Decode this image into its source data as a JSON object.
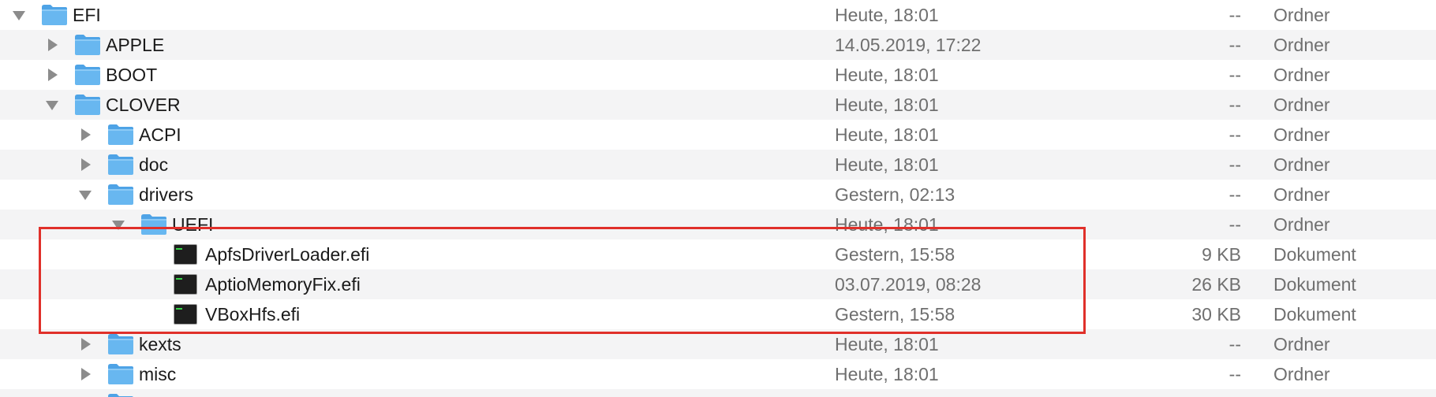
{
  "colors": {
    "folder_blue": "#68b7f0",
    "row_alt": "#f4f4f5",
    "highlight_red": "#e0302a",
    "secondary_text": "#6f6f6f"
  },
  "rows": [
    {
      "name": "EFI",
      "date": "Heute, 18:01",
      "size": "--",
      "kind": "Ordner",
      "icon": "folder-icon",
      "disclosure": "expanded",
      "level": 0
    },
    {
      "name": "APPLE",
      "date": "14.05.2019, 17:22",
      "size": "--",
      "kind": "Ordner",
      "icon": "folder-icon",
      "disclosure": "collapsed",
      "level": 1
    },
    {
      "name": "BOOT",
      "date": "Heute, 18:01",
      "size": "--",
      "kind": "Ordner",
      "icon": "folder-icon",
      "disclosure": "collapsed",
      "level": 1
    },
    {
      "name": "CLOVER",
      "date": "Heute, 18:01",
      "size": "--",
      "kind": "Ordner",
      "icon": "folder-icon",
      "disclosure": "expanded",
      "level": 1
    },
    {
      "name": "ACPI",
      "date": "Heute, 18:01",
      "size": "--",
      "kind": "Ordner",
      "icon": "folder-icon",
      "disclosure": "collapsed",
      "level": 2
    },
    {
      "name": "doc",
      "date": "Heute, 18:01",
      "size": "--",
      "kind": "Ordner",
      "icon": "folder-icon",
      "disclosure": "collapsed",
      "level": 2
    },
    {
      "name": "drivers",
      "date": "Gestern, 02:13",
      "size": "--",
      "kind": "Ordner",
      "icon": "folder-icon",
      "disclosure": "expanded",
      "level": 2
    },
    {
      "name": "UEFI",
      "date": "Heute, 18:01",
      "size": "--",
      "kind": "Ordner",
      "icon": "folder-icon",
      "disclosure": "expanded",
      "level": 3
    },
    {
      "name": "ApfsDriverLoader.efi",
      "date": "Gestern, 15:58",
      "size": "9 KB",
      "kind": "Dokument",
      "icon": "executable-icon",
      "disclosure": "none",
      "level": 4
    },
    {
      "name": "AptioMemoryFix.efi",
      "date": "03.07.2019, 08:28",
      "size": "26 KB",
      "kind": "Dokument",
      "icon": "executable-icon",
      "disclosure": "none",
      "level": 4
    },
    {
      "name": "VBoxHfs.efi",
      "date": "Gestern, 15:58",
      "size": "30 KB",
      "kind": "Dokument",
      "icon": "executable-icon",
      "disclosure": "none",
      "level": 4
    },
    {
      "name": "kexts",
      "date": "Heute, 18:01",
      "size": "--",
      "kind": "Ordner",
      "icon": "folder-icon",
      "disclosure": "collapsed",
      "level": 2
    },
    {
      "name": "misc",
      "date": "Heute, 18:01",
      "size": "--",
      "kind": "Ordner",
      "icon": "folder-icon",
      "disclosure": "collapsed",
      "level": 2
    }
  ],
  "partial_row": {
    "icon": "folder-icon",
    "level": 2
  }
}
